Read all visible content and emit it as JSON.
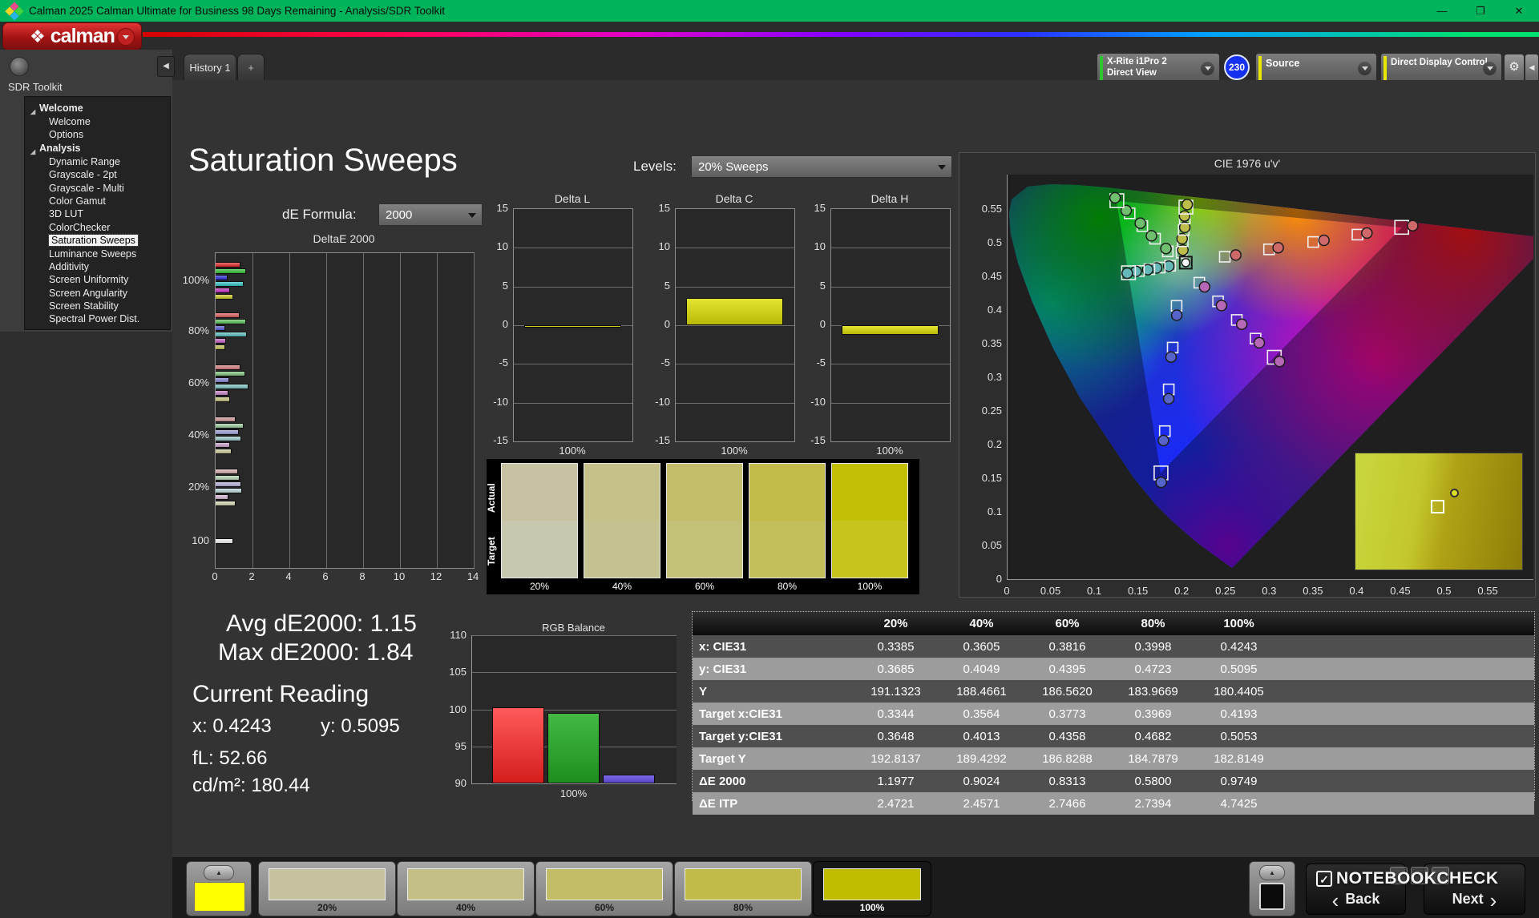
{
  "titlebar": {
    "title": "Calman 2025 Calman Ultimate for Business 98 Days Remaining  - Analysis/SDR Toolkit"
  },
  "icons": {
    "minimize": "—",
    "maximize": "❐",
    "close": "✕",
    "gear": "⚙",
    "collapse_left": "◀",
    "up_arrow": "▲",
    "back_chevron": "‹",
    "next_chevron": "›",
    "tree_expander": "◢",
    "logo_diamond": "❖",
    "check": "✓"
  },
  "logo": {
    "brand": "calman"
  },
  "tabs": {
    "items": [
      {
        "label": "History 1"
      }
    ],
    "add_label": "+"
  },
  "meter_bar": {
    "meter_line1": "X-Rite i1Pro 2",
    "meter_line2": "Direct View",
    "meter_stripe": "#2ec62e",
    "badge": "230",
    "badge_color": "#1530ee",
    "source_label": "Source",
    "source_stripe": "#e8e800",
    "display_label": "Direct Display Control",
    "display_stripe": "#e8e800"
  },
  "sidebar": {
    "title": "SDR Toolkit",
    "groups": [
      {
        "label": "Welcome",
        "items": [
          {
            "label": "Welcome"
          },
          {
            "label": "Options"
          }
        ]
      },
      {
        "label": "Analysis",
        "items": [
          {
            "label": "Dynamic Range"
          },
          {
            "label": "Grayscale - 2pt"
          },
          {
            "label": "Grayscale - Multi"
          },
          {
            "label": "Color Gamut"
          },
          {
            "label": "3D LUT"
          },
          {
            "label": "ColorChecker"
          },
          {
            "label": "Saturation Sweeps",
            "selected": true
          },
          {
            "label": "Luminance Sweeps"
          },
          {
            "label": "Additivity"
          },
          {
            "label": "Screen Uniformity"
          },
          {
            "label": "Screen Angularity"
          },
          {
            "label": "Screen Stability"
          },
          {
            "label": "Spectral Power Dist."
          }
        ]
      }
    ]
  },
  "main": {
    "title": "Saturation Sweeps",
    "de_formula_label": "dE Formula:",
    "de_formula_value": "2000",
    "levels_label": "Levels:",
    "levels_value": "20% Sweeps"
  },
  "charts": {
    "deltae": {
      "title": "DeltaE 2000",
      "xticks": [
        0,
        2,
        4,
        6,
        8,
        10,
        12,
        14
      ],
      "groups": [
        {
          "label": "100%",
          "values": [
            1.35,
            1.65,
            0.65,
            1.5,
            0.8,
            0.95
          ],
          "colors": [
            "#e02424",
            "#2fc12f",
            "#2c2cdc",
            "#2fc1c1",
            "#c12fc1",
            "#c9c920"
          ]
        },
        {
          "label": "80%",
          "values": [
            1.3,
            1.65,
            0.5,
            1.7,
            0.55,
            0.5
          ],
          "colors": [
            "#db5a5a",
            "#5ac05a",
            "#5a5ad2",
            "#5abebe",
            "#c05ec0",
            "#c2c256"
          ]
        },
        {
          "label": "60%",
          "values": [
            1.35,
            1.6,
            0.75,
            1.8,
            0.7,
            0.8
          ],
          "colors": [
            "#d47c7c",
            "#7cc47c",
            "#8484d4",
            "#7fc4c4",
            "#c480c4",
            "#c4c47e"
          ]
        },
        {
          "label": "40%",
          "values": [
            1.1,
            1.5,
            1.25,
            1.4,
            0.8,
            0.85
          ],
          "colors": [
            "#d09898",
            "#9ccb9c",
            "#9c9cd6",
            "#9ccaca",
            "#cb9ecb",
            "#cbcb9a"
          ]
        },
        {
          "label": "20%",
          "values": [
            1.2,
            1.3,
            1.4,
            1.45,
            0.7,
            1.1
          ],
          "colors": [
            "#d6aeae",
            "#b4d4b4",
            "#b2b2da",
            "#bad8d8",
            "#d4b6d4",
            "#d6d6b0"
          ]
        },
        {
          "label": "100",
          "values": [
            0.95
          ],
          "colors": [
            "#f2f2f2"
          ]
        }
      ]
    },
    "delta_yticks": [
      15,
      10,
      5,
      0,
      -5,
      -10,
      -15
    ],
    "delta_l": {
      "title": "Delta L",
      "value": -0.3,
      "xlabel": "100%"
    },
    "delta_c": {
      "title": "Delta C",
      "value": 3.5,
      "xlabel": "100%"
    },
    "delta_h": {
      "title": "Delta H",
      "value": -1.2,
      "xlabel": "100%"
    },
    "rgb_balance": {
      "title": "RGB Balance",
      "xlabel": "100%",
      "yticks": [
        110,
        105,
        100,
        95,
        90
      ],
      "bars": [
        {
          "name": "red",
          "color_top": "#ff5a5a",
          "color_bottom": "#d51e1e",
          "value": 100.3
        },
        {
          "name": "green",
          "color_top": "#43b943",
          "color_bottom": "#1e8f1e",
          "value": 99.5
        },
        {
          "name": "blue",
          "color_top": "#7a6ae6",
          "color_bottom": "#5747c8",
          "value": 91.2
        }
      ]
    }
  },
  "swatches": {
    "actual_label": "Actual",
    "target_label": "Target",
    "items": [
      {
        "label": "20%",
        "actual": "#c6c2a2",
        "target": "#c8c8b0"
      },
      {
        "label": "40%",
        "actual": "#c6c189",
        "target": "#c5c292"
      },
      {
        "label": "60%",
        "actual": "#c4bd6b",
        "target": "#c3c077"
      },
      {
        "label": "80%",
        "actual": "#c3bc4a",
        "target": "#c2bf5a"
      },
      {
        "label": "100%",
        "actual": "#c2bf04",
        "target": "#c7c41d"
      }
    ]
  },
  "cie": {
    "title": "CIE 1976 u'v'",
    "yticks": [
      "0.55",
      "0.5",
      "0.45",
      "0.4",
      "0.35",
      "0.3",
      "0.25",
      "0.2",
      "0.15",
      "0.1",
      "0.05",
      "0"
    ],
    "xticks": [
      "0",
      "0.05",
      "0.1",
      "0.15",
      "0.2",
      "0.25",
      "0.3",
      "0.35",
      "0.4",
      "0.45",
      "0.5",
      "0.55"
    ],
    "white_point": [
      0.1978,
      0.4683
    ],
    "fractions": [
      0.2,
      0.4,
      0.6,
      0.8,
      1.0
    ],
    "sweeps": [
      {
        "name": "red",
        "primary": [
          0.4507,
          0.5229
        ],
        "color": "#cf6868"
      },
      {
        "name": "green",
        "primary": [
          0.125,
          0.5625
        ],
        "color": "#6fbf6f"
      },
      {
        "name": "blue",
        "primary": [
          0.1754,
          0.1579
        ],
        "color": "#5663c9"
      },
      {
        "name": "cyan",
        "primary": [
          0.1383,
          0.4554
        ],
        "color": "#66b8b8"
      },
      {
        "name": "magenta",
        "primary": [
          0.305,
          0.3298
        ],
        "color": "#b668b6"
      },
      {
        "name": "yellow",
        "primary": [
          0.2039,
          0.5529
        ],
        "color": "#bdbd4a"
      }
    ]
  },
  "stats": {
    "avg": "Avg dE2000: 1.15",
    "max": "Max dE2000: 1.84",
    "current_title": "Current Reading",
    "x": "x: 0.4243",
    "y": "y: 0.5095",
    "fl": "fL: 52.66",
    "cd": "cd/m²: 180.44"
  },
  "table": {
    "columns": [
      "",
      "20%",
      "40%",
      "60%",
      "80%",
      "100%"
    ],
    "rows": [
      {
        "label": "x: CIE31",
        "values": [
          "0.3385",
          "0.3605",
          "0.3816",
          "0.3998",
          "0.4243"
        ]
      },
      {
        "label": "y: CIE31",
        "values": [
          "0.3685",
          "0.4049",
          "0.4395",
          "0.4723",
          "0.5095"
        ]
      },
      {
        "label": "Y",
        "values": [
          "191.1323",
          "188.4661",
          "186.5620",
          "183.9669",
          "180.4405"
        ]
      },
      {
        "label": "Target x:CIE31",
        "values": [
          "0.3344",
          "0.3564",
          "0.3773",
          "0.3969",
          "0.4193"
        ]
      },
      {
        "label": "Target y:CIE31",
        "values": [
          "0.3648",
          "0.4013",
          "0.4358",
          "0.4682",
          "0.5053"
        ]
      },
      {
        "label": "Target Y",
        "values": [
          "192.8137",
          "189.4292",
          "186.8288",
          "184.7879",
          "182.8149"
        ]
      },
      {
        "label": "ΔE 2000",
        "values": [
          "1.1977",
          "0.9024",
          "0.8313",
          "0.5800",
          "0.9749"
        ]
      },
      {
        "label": "ΔE ITP",
        "values": [
          "2.4721",
          "2.4571",
          "2.7466",
          "2.7394",
          "4.7425"
        ]
      }
    ]
  },
  "bottom": {
    "generator_color": "#ffff00",
    "patches": [
      {
        "label": "20%",
        "color": "#c6c2a0"
      },
      {
        "label": "40%",
        "color": "#c4bf86"
      },
      {
        "label": "60%",
        "color": "#c2bd67"
      },
      {
        "label": "80%",
        "color": "#c1bc49"
      },
      {
        "label": "100%",
        "color": "#c0bd00",
        "selected": true
      }
    ],
    "back_label": "Back",
    "next_label": "Next",
    "watermark": "NOTEBOOKCHECK"
  }
}
